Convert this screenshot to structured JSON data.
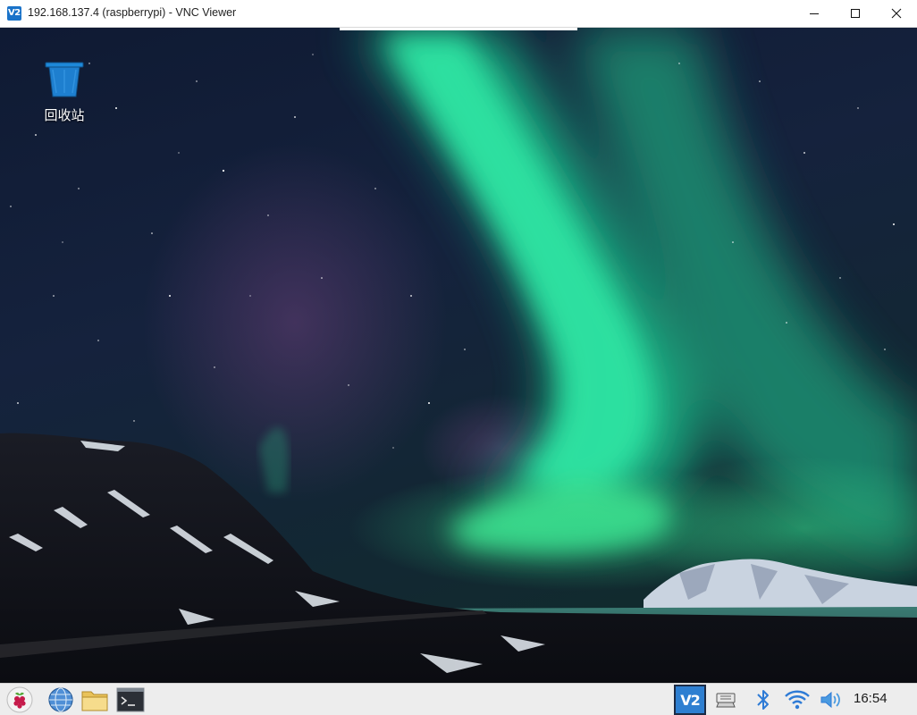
{
  "window": {
    "title": "192.168.137.4 (raspberrypi) - VNC Viewer",
    "app_icon_text": "V2"
  },
  "desktop": {
    "icons": [
      {
        "label": "回收站",
        "icon": "trash-icon"
      }
    ]
  },
  "taskbar": {
    "launchers": [
      "raspberry-menu-icon",
      "web-browser-icon",
      "file-manager-icon",
      "terminal-icon"
    ],
    "tray": [
      "vnc-server-icon",
      "network-share-icon",
      "bluetooth-icon",
      "wifi-icon",
      "volume-icon"
    ],
    "vnc_tray_text": "V2",
    "clock": "16:54"
  },
  "colors": {
    "aurora": "#1fd69a",
    "sky": "#0c1527",
    "vnc_blue": "#2e7fd1",
    "taskbar": "#ededed"
  }
}
